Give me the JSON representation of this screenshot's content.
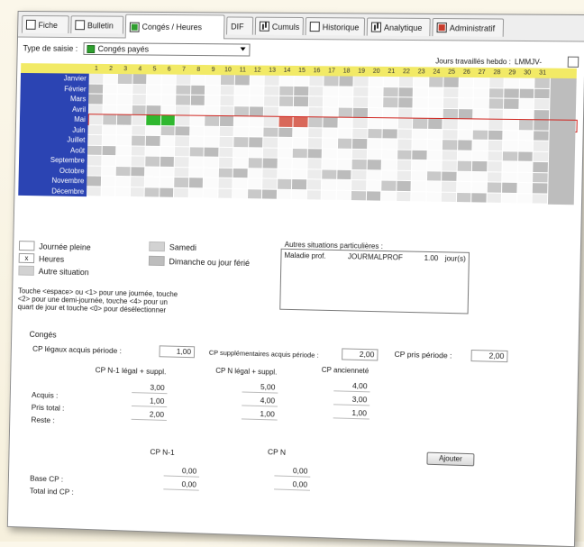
{
  "tabs": [
    {
      "label": "Fiche",
      "icon": "fiche-icon"
    },
    {
      "label": "Bulletin",
      "icon": "bulletin-icon"
    },
    {
      "label": "Congés / Heures",
      "icon": "conges-icon"
    },
    {
      "label": "DIF",
      "icon": ""
    },
    {
      "label": "Cumuls",
      "icon": "cumuls-icon"
    },
    {
      "label": "Historique",
      "icon": "historique-icon"
    },
    {
      "label": "Analytique",
      "icon": "analytique-icon"
    },
    {
      "label": "Administratif",
      "icon": "administratif-icon"
    }
  ],
  "type_saisie": {
    "label": "Type de saisie :",
    "value": "Congés payés",
    "color": "#2ea12e"
  },
  "jours_travailles": {
    "label": "Jours travaillés hebdo :",
    "value": "LMMJV-"
  },
  "calendar": {
    "days": [
      "1",
      "2",
      "3",
      "4",
      "5",
      "6",
      "7",
      "8",
      "9",
      "10",
      "11",
      "12",
      "13",
      "14",
      "15",
      "16",
      "17",
      "18",
      "19",
      "20",
      "21",
      "22",
      "23",
      "24",
      "25",
      "26",
      "27",
      "28",
      "29",
      "30",
      "31"
    ],
    "months": [
      "Janvier",
      "Février",
      "Mars",
      "Avril",
      "Mai",
      "Juin",
      "Juillet",
      "Août",
      "Septembre",
      "Octobre",
      "Novembre",
      "Décembre"
    ],
    "selected_month": "Mai",
    "header_color": "#f2ea66",
    "month_color": "#2b44b3",
    "highlight_color": "#d0251f"
  },
  "legend": {
    "journee_pleine": "Journée pleine",
    "heures": "Heures",
    "heures_mark": "x",
    "autre_situation": "Autre situation",
    "samedi": "Samedi",
    "dimanche": "Dimanche ou jour férié",
    "help": "Touche <espace> ou <1> pour une journée, touche <2> pour une demi-journée, touche <4> pour un quart de jour et touche <0> pour désélectionner"
  },
  "autres": {
    "title": "Autres situations particulières :",
    "rows": [
      {
        "label": "Maladie prof.",
        "code": "JOURMALPROF",
        "value": "1.00",
        "unit": "jour(s)"
      }
    ]
  },
  "conges": {
    "title": "Congés",
    "cp_legaux_label": "CP légaux acquis période :",
    "cp_legaux_value": "1,00",
    "cp_supp_label": "CP supplémentaires acquis période :",
    "cp_supp_value": "2,00",
    "cp_pris_label": "CP pris période :",
    "cp_pris_value": "2,00",
    "col_n1_header": "CP N-1 légal + suppl.",
    "col_n_header": "CP N légal + suppl.",
    "col_anc_header": "CP ancienneté",
    "row_acquis": "Acquis :",
    "row_pris": "Pris total :",
    "row_reste": "Reste :",
    "n1": [
      "3,00",
      "1,00",
      "2,00"
    ],
    "n": [
      "5,00",
      "4,00",
      "1,00"
    ],
    "anc": [
      "4,00",
      "3,00",
      "1,00"
    ],
    "base_label": "Base CP :",
    "total_ind_label": "Total ind CP :",
    "base_n1_header": "CP N-1",
    "base_n_header": "CP N",
    "base_n1": [
      "0,00",
      "0,00"
    ],
    "base_n": [
      "0,00",
      "0,00"
    ],
    "ajouter_label": "Ajouter"
  }
}
